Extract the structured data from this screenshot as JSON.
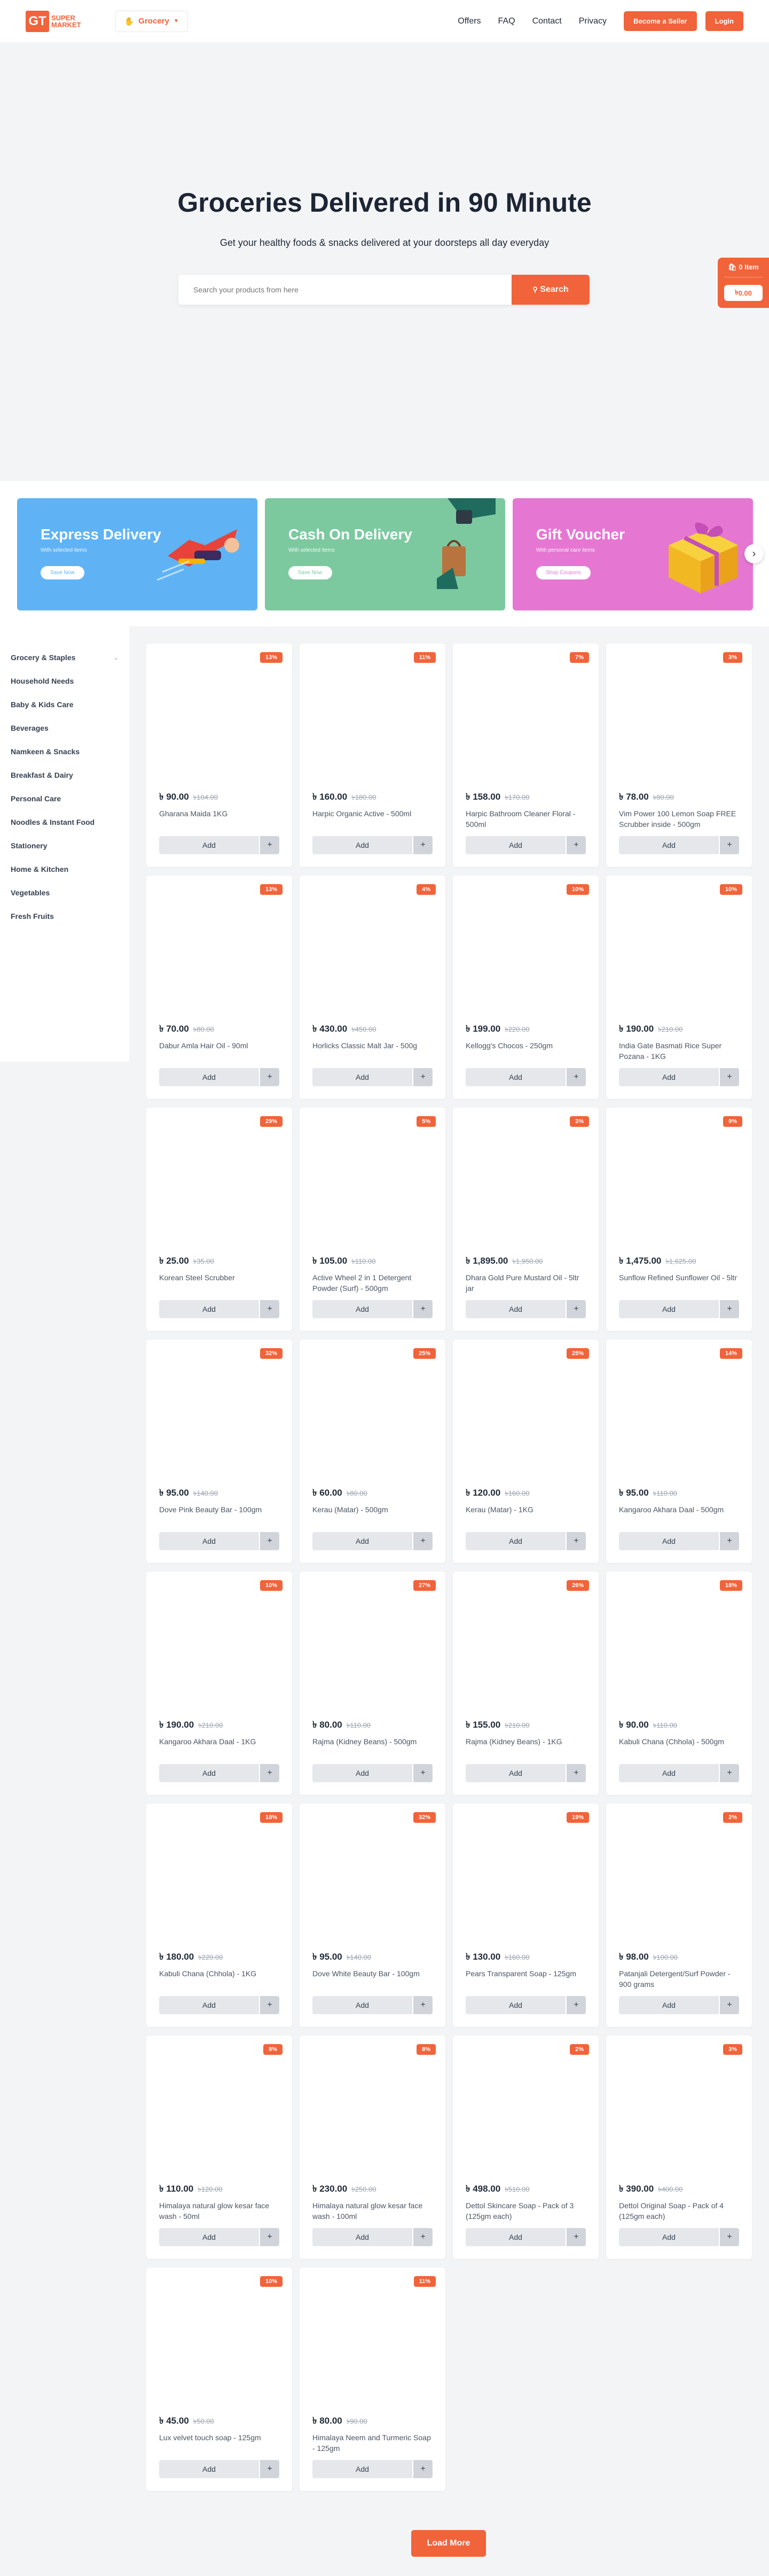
{
  "header": {
    "logo_mark": "GT",
    "logo_line1": "SUPER",
    "logo_line2": "MARKET",
    "store_selector": "Grocery",
    "nav": [
      "Offers",
      "FAQ",
      "Contact",
      "Privacy"
    ],
    "become_seller": "Become a Seller",
    "login": "Login"
  },
  "hero": {
    "title": "Groceries Delivered in 90 Minute",
    "subtitle": "Get your healthy foods & snacks delivered at your doorsteps all day everyday",
    "search_placeholder": "Search your products from here",
    "search_button": "Search"
  },
  "cart": {
    "count_label": "0 Item",
    "total": "0.00"
  },
  "banners": [
    {
      "title": "Express Delivery",
      "subtitle": "With selected items",
      "cta": "Save Now",
      "color": "#5fb3f5"
    },
    {
      "title": "Cash On Delivery",
      "subtitle": "With selected items",
      "cta": "Save Now",
      "color": "#7cc9a0"
    },
    {
      "title": "Gift Voucher",
      "subtitle": "With personal care items",
      "cta": "Shop Coupons",
      "color": "#e577d3"
    }
  ],
  "categories": [
    "Grocery & Staples",
    "Household Needs",
    "Baby & Kids Care",
    "Beverages",
    "Namkeen & Snacks",
    "Breakfast & Dairy",
    "Personal Care",
    "Noodles & Instant Food",
    "Stationery",
    "Home & Kitchen",
    "Vegetables",
    "Fresh Fruits"
  ],
  "currency_symbol": "৳",
  "add_label": "Add",
  "products": [
    {
      "name": "Gharana Maida 1KG",
      "price": "90.00",
      "old": "104.00",
      "discount": "13%"
    },
    {
      "name": "Harpic Organic Active - 500ml",
      "price": "160.00",
      "old": "180.00",
      "discount": "11%"
    },
    {
      "name": "Harpic Bathroom Cleaner Floral - 500ml",
      "price": "158.00",
      "old": "170.00",
      "discount": "7%"
    },
    {
      "name": "Vim Power 100 Lemon Soap FREE Scrubber inside - 500gm",
      "price": "78.00",
      "old": "80.00",
      "discount": "3%"
    },
    {
      "name": "Dabur Amla Hair Oil - 90ml",
      "price": "70.00",
      "old": "80.00",
      "discount": "13%"
    },
    {
      "name": "Horlicks Classic Malt Jar - 500g",
      "price": "430.00",
      "old": "450.00",
      "discount": "4%"
    },
    {
      "name": "Kellogg's Chocos - 250gm",
      "price": "199.00",
      "old": "220.00",
      "discount": "10%"
    },
    {
      "name": "India Gate Basmati Rice Super Pozana - 1KG",
      "price": "190.00",
      "old": "210.00",
      "discount": "10%"
    },
    {
      "name": "Korean Steel Scrubber",
      "price": "25.00",
      "old": "35.00",
      "discount": "29%"
    },
    {
      "name": "Active Wheel 2 in 1 Detergent Powder (Surf) - 500gm",
      "price": "105.00",
      "old": "110.00",
      "discount": "5%"
    },
    {
      "name": "Dhara Gold Pure Mustard Oil - 5ltr jar",
      "price": "1,895.00",
      "old": "1,950.00",
      "discount": "3%"
    },
    {
      "name": "Sunflow Refined Sunflower Oil - 5ltr",
      "price": "1,475.00",
      "old": "1,625.00",
      "discount": "9%"
    },
    {
      "name": "Dove Pink Beauty Bar - 100gm",
      "price": "95.00",
      "old": "140.00",
      "discount": "32%"
    },
    {
      "name": "Kerau (Matar) - 500gm",
      "price": "60.00",
      "old": "80.00",
      "discount": "25%"
    },
    {
      "name": "Kerau (Matar) - 1KG",
      "price": "120.00",
      "old": "160.00",
      "discount": "25%"
    },
    {
      "name": "Kangaroo Akhara Daal - 500gm",
      "price": "95.00",
      "old": "110.00",
      "discount": "14%"
    },
    {
      "name": "Kangaroo Akhara Daal - 1KG",
      "price": "190.00",
      "old": "210.00",
      "discount": "10%"
    },
    {
      "name": "Rajma (Kidney Beans) - 500gm",
      "price": "80.00",
      "old": "110.00",
      "discount": "27%"
    },
    {
      "name": "Rajma (Kidney Beans) - 1KG",
      "price": "155.00",
      "old": "210.00",
      "discount": "26%"
    },
    {
      "name": "Kabuli Chana (Chhola) - 500gm",
      "price": "90.00",
      "old": "110.00",
      "discount": "18%"
    },
    {
      "name": "Kabuli Chana (Chhola) - 1KG",
      "price": "180.00",
      "old": "220.00",
      "discount": "18%"
    },
    {
      "name": "Dove White Beauty Bar - 100gm",
      "price": "95.00",
      "old": "140.00",
      "discount": "32%"
    },
    {
      "name": "Pears Transparent Soap - 125gm",
      "price": "130.00",
      "old": "160.00",
      "discount": "19%"
    },
    {
      "name": "Patanjali Detergent/Surf Powder - 900 grams",
      "price": "98.00",
      "old": "100.00",
      "discount": "2%"
    },
    {
      "name": "Himalaya natural glow kesar face wash - 50ml",
      "price": "110.00",
      "old": "120.00",
      "discount": "8%"
    },
    {
      "name": "Himalaya natural glow kesar face wash - 100ml",
      "price": "230.00",
      "old": "250.00",
      "discount": "8%"
    },
    {
      "name": "Dettol Skincare Soap - Pack of 3 (125gm each)",
      "price": "498.00",
      "old": "510.00",
      "discount": "2%"
    },
    {
      "name": "Dettol Original Soap - Pack of 4 (125gm each)",
      "price": "390.00",
      "old": "400.00",
      "discount": "3%"
    },
    {
      "name": "Lux velvet touch soap - 125gm",
      "price": "45.00",
      "old": "50.00",
      "discount": "10%"
    },
    {
      "name": "Himalaya Neem and Turmeric Soap - 125gm",
      "price": "80.00",
      "old": "90.00",
      "discount": "11%"
    }
  ],
  "load_more": "Load More",
  "colors": {
    "accent": "#f1633a",
    "background": "#f3f4f6"
  }
}
